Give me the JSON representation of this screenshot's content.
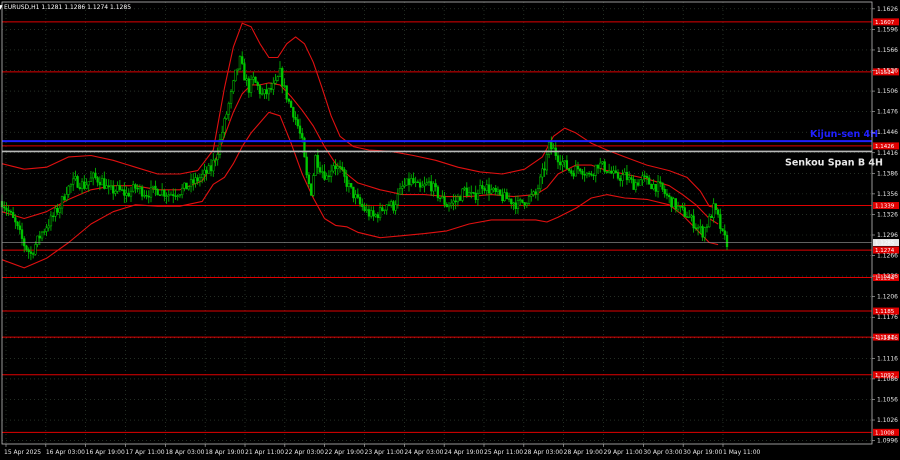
{
  "chart_data": {
    "type": "candlestick",
    "title": "EURUSD,H1  1.1281 1.1286 1.1274 1.1285",
    "symbol_marker": "▼",
    "ylim": [
      1.0991,
      1.1636
    ],
    "y_ticks": [
      "1.1626",
      "1.1596",
      "1.1566",
      "1.1536",
      "1.1506",
      "1.1476",
      "1.1446",
      "1.1416",
      "1.1386",
      "1.1356",
      "1.1326",
      "1.1296",
      "1.1266",
      "1.1236",
      "1.1206",
      "1.1176",
      "1.1146",
      "1.1116",
      "1.1086",
      "1.1056",
      "1.1026",
      "1.0996"
    ],
    "x_ticks": [
      "15 Apr 2025",
      "16 Apr 03:00",
      "16 Apr 19:00",
      "17 Apr 11:00",
      "18 Apr 03:00",
      "18 Apr 19:00",
      "21 Apr 11:00",
      "22 Apr 03:00",
      "22 Apr 19:00",
      "23 Apr 11:00",
      "24 Apr 03:00",
      "24 Apr 19:00",
      "25 Apr 11:00",
      "28 Apr 03:00",
      "28 Apr 19:00",
      "29 Apr 11:00",
      "30 Apr 03:00",
      "30 Apr 19:00",
      "1 May 11:00"
    ],
    "current_price": "1.1285",
    "grid": true,
    "colors": {
      "background": "#000000",
      "grid": "#3a4a3a",
      "candle": "#00c800",
      "bollinger": "#e01010",
      "level": "#e00000",
      "kijun": "#2020ff",
      "senkou": "#b8b8b8",
      "price_label_bg": "#e6e6e6"
    },
    "levels": [
      {
        "label": "1.1607",
        "value": 1.1607
      },
      {
        "label": "1.1534",
        "value": 1.1534
      },
      {
        "label": "1.1426",
        "value": 1.1426
      },
      {
        "label": "1.1339",
        "value": 1.1339
      },
      {
        "label": "1.1274",
        "value": 1.1274
      },
      {
        "label": "1.1234",
        "value": 1.1234
      },
      {
        "label": "1.1185",
        "value": 1.1185
      },
      {
        "label": "1.1147",
        "value": 1.1147
      },
      {
        "label": "1.1092",
        "value": 1.1092
      },
      {
        "label": "1.1008",
        "value": 1.1008
      }
    ],
    "annotations": {
      "kijun": {
        "label": "Kijun-sen 4H",
        "value": 1.1433
      },
      "senkou": {
        "label": "Senkou Span B 4H",
        "value": 1.1418
      }
    },
    "close_path": [
      [
        0,
        1.1345
      ],
      [
        3,
        1.133
      ],
      [
        6,
        1.1312
      ],
      [
        10,
        1.1282
      ],
      [
        13,
        1.1268
      ],
      [
        15,
        1.1282
      ],
      [
        18,
        1.13
      ],
      [
        22,
        1.1318
      ],
      [
        26,
        1.1338
      ],
      [
        29,
        1.1362
      ],
      [
        33,
        1.1375
      ],
      [
        37,
        1.1368
      ],
      [
        41,
        1.138
      ],
      [
        45,
        1.1375
      ],
      [
        48,
        1.136
      ],
      [
        52,
        1.1362
      ],
      [
        56,
        1.1355
      ],
      [
        60,
        1.1365
      ],
      [
        65,
        1.1357
      ],
      [
        70,
        1.1362
      ],
      [
        75,
        1.1356
      ],
      [
        80,
        1.136
      ],
      [
        85,
        1.137
      ],
      [
        90,
        1.1382
      ],
      [
        94,
        1.1392
      ],
      [
        97,
        1.142
      ],
      [
        100,
        1.146
      ],
      [
        103,
        1.15
      ],
      [
        105,
        1.153
      ],
      [
        107,
        1.155
      ],
      [
        109,
        1.1528
      ],
      [
        111,
        1.151
      ],
      [
        113,
        1.1522
      ],
      [
        115,
        1.1512
      ],
      [
        117,
        1.15
      ],
      [
        120,
        1.1505
      ],
      [
        123,
        1.1515
      ],
      [
        125,
        1.1532
      ],
      [
        127,
        1.1508
      ],
      [
        129,
        1.149
      ],
      [
        131,
        1.1475
      ],
      [
        133,
        1.1455
      ],
      [
        135,
        1.143
      ],
      [
        137,
        1.138
      ],
      [
        139,
        1.136
      ],
      [
        141,
        1.141
      ],
      [
        143,
        1.1395
      ],
      [
        146,
        1.138
      ],
      [
        149,
        1.14
      ],
      [
        152,
        1.139
      ],
      [
        155,
        1.1372
      ],
      [
        158,
        1.1355
      ],
      [
        161,
        1.134
      ],
      [
        164,
        1.133
      ],
      [
        167,
        1.1322
      ],
      [
        170,
        1.133
      ],
      [
        173,
        1.1342
      ],
      [
        176,
        1.1338
      ],
      [
        180,
        1.1365
      ],
      [
        184,
        1.1375
      ],
      [
        188,
        1.1362
      ],
      [
        192,
        1.1372
      ],
      [
        196,
        1.1355
      ],
      [
        200,
        1.134
      ],
      [
        204,
        1.1345
      ],
      [
        208,
        1.1362
      ],
      [
        212,
        1.135
      ],
      [
        216,
        1.137
      ],
      [
        220,
        1.136
      ],
      [
        224,
        1.1352
      ],
      [
        228,
        1.1348
      ],
      [
        232,
        1.134
      ],
      [
        236,
        1.1348
      ],
      [
        240,
        1.1355
      ],
      [
        244,
        1.1395
      ],
      [
        246,
        1.1425
      ],
      [
        248,
        1.142
      ],
      [
        250,
        1.141
      ],
      [
        253,
        1.1398
      ],
      [
        256,
        1.1388
      ],
      [
        260,
        1.1395
      ],
      [
        264,
        1.1382
      ],
      [
        268,
        1.14
      ],
      [
        272,
        1.1392
      ],
      [
        276,
        1.138
      ],
      [
        280,
        1.1382
      ],
      [
        284,
        1.137
      ],
      [
        288,
        1.1378
      ],
      [
        292,
        1.137
      ],
      [
        296,
        1.1365
      ],
      [
        300,
        1.1348
      ],
      [
        304,
        1.1335
      ],
      [
        308,
        1.1325
      ],
      [
        312,
        1.131
      ],
      [
        315,
        1.13
      ],
      [
        318,
        1.1318
      ],
      [
        320,
        1.1335
      ],
      [
        322,
        1.132
      ],
      [
        324,
        1.1295
      ],
      [
        326,
        1.1285
      ]
    ],
    "bollinger_upper": [
      [
        0,
        1.14
      ],
      [
        10,
        1.1392
      ],
      [
        20,
        1.1395
      ],
      [
        30,
        1.141
      ],
      [
        40,
        1.1412
      ],
      [
        50,
        1.1405
      ],
      [
        60,
        1.1395
      ],
      [
        70,
        1.1385
      ],
      [
        80,
        1.1385
      ],
      [
        88,
        1.139
      ],
      [
        95,
        1.142
      ],
      [
        100,
        1.151
      ],
      [
        104,
        1.157
      ],
      [
        108,
        1.1605
      ],
      [
        112,
        1.16
      ],
      [
        116,
        1.1575
      ],
      [
        120,
        1.1555
      ],
      [
        124,
        1.1555
      ],
      [
        128,
        1.1575
      ],
      [
        132,
        1.1585
      ],
      [
        136,
        1.1575
      ],
      [
        140,
        1.1548
      ],
      [
        144,
        1.151
      ],
      [
        148,
        1.147
      ],
      [
        152,
        1.144
      ],
      [
        158,
        1.1425
      ],
      [
        165,
        1.142
      ],
      [
        175,
        1.1418
      ],
      [
        185,
        1.1412
      ],
      [
        195,
        1.1405
      ],
      [
        205,
        1.1395
      ],
      [
        215,
        1.1388
      ],
      [
        225,
        1.1385
      ],
      [
        235,
        1.1392
      ],
      [
        243,
        1.141
      ],
      [
        248,
        1.144
      ],
      [
        253,
        1.1452
      ],
      [
        258,
        1.1445
      ],
      [
        265,
        1.143
      ],
      [
        272,
        1.142
      ],
      [
        280,
        1.141
      ],
      [
        290,
        1.1398
      ],
      [
        300,
        1.139
      ],
      [
        308,
        1.138
      ],
      [
        314,
        1.136
      ],
      [
        318,
        1.1338
      ],
      [
        322,
        1.1335
      ]
    ],
    "bollinger_middle": [
      [
        0,
        1.133
      ],
      [
        10,
        1.132
      ],
      [
        20,
        1.133
      ],
      [
        30,
        1.1348
      ],
      [
        40,
        1.1362
      ],
      [
        50,
        1.1368
      ],
      [
        60,
        1.1368
      ],
      [
        70,
        1.1362
      ],
      [
        80,
        1.1362
      ],
      [
        90,
        1.1375
      ],
      [
        96,
        1.1405
      ],
      [
        100,
        1.144
      ],
      [
        104,
        1.1475
      ],
      [
        108,
        1.1502
      ],
      [
        112,
        1.1515
      ],
      [
        116,
        1.1515
      ],
      [
        120,
        1.1518
      ],
      [
        125,
        1.1515
      ],
      [
        130,
        1.1498
      ],
      [
        135,
        1.1478
      ],
      [
        140,
        1.1455
      ],
      [
        145,
        1.1425
      ],
      [
        150,
        1.14
      ],
      [
        155,
        1.1385
      ],
      [
        160,
        1.1372
      ],
      [
        170,
        1.1362
      ],
      [
        180,
        1.1355
      ],
      [
        190,
        1.1355
      ],
      [
        200,
        1.1352
      ],
      [
        210,
        1.1352
      ],
      [
        220,
        1.1355
      ],
      [
        230,
        1.1352
      ],
      [
        240,
        1.1355
      ],
      [
        245,
        1.1365
      ],
      [
        250,
        1.1385
      ],
      [
        258,
        1.1398
      ],
      [
        265,
        1.1398
      ],
      [
        272,
        1.139
      ],
      [
        280,
        1.1385
      ],
      [
        290,
        1.1378
      ],
      [
        300,
        1.1368
      ],
      [
        306,
        1.1355
      ],
      [
        312,
        1.134
      ],
      [
        318,
        1.132
      ],
      [
        322,
        1.1312
      ]
    ],
    "bollinger_lower": [
      [
        0,
        1.126
      ],
      [
        10,
        1.1248
      ],
      [
        20,
        1.1262
      ],
      [
        30,
        1.1285
      ],
      [
        40,
        1.1312
      ],
      [
        50,
        1.133
      ],
      [
        60,
        1.134
      ],
      [
        70,
        1.1338
      ],
      [
        80,
        1.1338
      ],
      [
        90,
        1.1345
      ],
      [
        95,
        1.137
      ],
      [
        100,
        1.138
      ],
      [
        104,
        1.14
      ],
      [
        108,
        1.1425
      ],
      [
        112,
        1.1445
      ],
      [
        116,
        1.146
      ],
      [
        120,
        1.1475
      ],
      [
        125,
        1.147
      ],
      [
        130,
        1.143
      ],
      [
        135,
        1.1385
      ],
      [
        140,
        1.135
      ],
      [
        145,
        1.132
      ],
      [
        150,
        1.131
      ],
      [
        155,
        1.1308
      ],
      [
        160,
        1.13
      ],
      [
        170,
        1.1292
      ],
      [
        180,
        1.1295
      ],
      [
        190,
        1.1298
      ],
      [
        200,
        1.1302
      ],
      [
        210,
        1.1312
      ],
      [
        220,
        1.1318
      ],
      [
        230,
        1.1318
      ],
      [
        240,
        1.1318
      ],
      [
        245,
        1.1315
      ],
      [
        250,
        1.1322
      ],
      [
        258,
        1.1335
      ],
      [
        265,
        1.135
      ],
      [
        272,
        1.1355
      ],
      [
        280,
        1.135
      ],
      [
        290,
        1.1348
      ],
      [
        300,
        1.134
      ],
      [
        306,
        1.1325
      ],
      [
        312,
        1.1305
      ],
      [
        318,
        1.1285
      ],
      [
        322,
        1.1282
      ]
    ]
  }
}
